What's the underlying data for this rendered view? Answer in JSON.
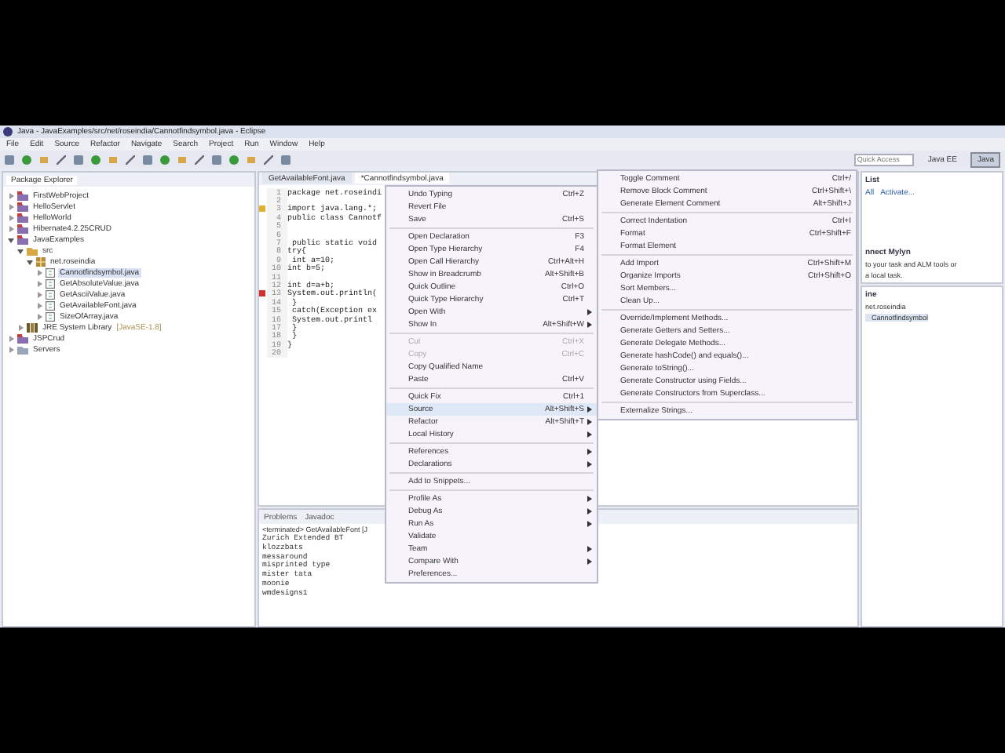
{
  "window": {
    "title": "Java - JavaExamples/src/net/roseindia/Cannotfindsymbol.java - Eclipse"
  },
  "menu_bar": [
    "File",
    "Edit",
    "Source",
    "Refactor",
    "Navigate",
    "Search",
    "Project",
    "Run",
    "Window",
    "Help"
  ],
  "toolbar": {
    "quick_access": {
      "placeholder": "Quick Access"
    },
    "perspectives": [
      {
        "label": "Java EE",
        "selected": false
      },
      {
        "label": "Java",
        "selected": true
      }
    ]
  },
  "package_explorer": {
    "title": "Package Explorer",
    "tree": [
      {
        "label": "FirstWebProject",
        "kind": "project",
        "expanded": false
      },
      {
        "label": "HelloServlet",
        "kind": "project",
        "expanded": false
      },
      {
        "label": "HelloWorld",
        "kind": "project",
        "expanded": false
      },
      {
        "label": "Hibernate4.2.25CRUD",
        "kind": "project",
        "expanded": false
      },
      {
        "label": "JavaExamples",
        "kind": "project",
        "expanded": true,
        "children": [
          {
            "label": "src",
            "kind": "folder",
            "expanded": true,
            "children": [
              {
                "label": "net.roseindia",
                "kind": "package",
                "expanded": true,
                "children": [
                  {
                    "label": "Cannotfindsymbol.java",
                    "kind": "file",
                    "expanded": false,
                    "selected": true
                  },
                  {
                    "label": "GetAbsoluteValue.java",
                    "kind": "file",
                    "expanded": false,
                    "selected": false
                  },
                  {
                    "label": "GetAsciiValue.java",
                    "kind": "file",
                    "expanded": false,
                    "selected": false
                  },
                  {
                    "label": "GetAvailableFont.java",
                    "kind": "file",
                    "expanded": false,
                    "selected": false
                  },
                  {
                    "label": "SizeOfArray.java",
                    "kind": "file",
                    "expanded": false,
                    "selected": false
                  }
                ]
              }
            ]
          },
          {
            "label": "JRE System Library",
            "note": "[JavaSE-1.8]",
            "kind": "library",
            "expanded": false
          }
        ]
      },
      {
        "label": "JSPCrud",
        "kind": "project",
        "expanded": false
      },
      {
        "label": "Servers",
        "kind": "servers",
        "expanded": false
      }
    ]
  },
  "editor": {
    "tabs": [
      {
        "label": "GetAvailableFont.java",
        "selected": false
      },
      {
        "label": "*Cannotfindsymbol.java",
        "selected": true
      }
    ],
    "lines": [
      {
        "number": "1",
        "text": "package net.roseindi"
      },
      {
        "number": "2"
      },
      {
        "number": "3",
        "text": "import java.lang.*;",
        "warning": true
      },
      {
        "number": "4",
        "text": "public class Cannotf"
      },
      {
        "number": "5"
      },
      {
        "number": "6"
      },
      {
        "number": "7",
        "text": " public static void"
      },
      {
        "number": "8",
        "text": "try{"
      },
      {
        "number": "9",
        "text": " int a=10;"
      },
      {
        "number": "10",
        "text": "int b=5;"
      },
      {
        "number": "11"
      },
      {
        "number": "12",
        "text": "int d=a+b;"
      },
      {
        "number": "13",
        "text": "System.out.println(",
        "error": true
      },
      {
        "number": "14",
        "text": " }"
      },
      {
        "number": "15",
        "text": " catch(Exception ex"
      },
      {
        "number": "16",
        "text": " System.out.printl"
      },
      {
        "number": "17",
        "text": " }"
      },
      {
        "number": "18",
        "text": " }"
      },
      {
        "number": "19",
        "text": "}"
      },
      {
        "number": "20"
      }
    ]
  },
  "console": {
    "tabs": [
      {
        "label": "Problems",
        "selected": false
      },
      {
        "label": "Javadoc",
        "selected": false
      }
    ],
    "header": "<terminated> GetAvailableFont [J",
    "lines": [
      "Zurich Extended BT",
      "klozzbats",
      "messaround",
      "misprinted type",
      "mister tata",
      "moonie",
      "wmdesigns1"
    ]
  },
  "context_menu": [
    {
      "kind": "item",
      "label": "Undo Typing",
      "shortcut": "Ctrl+Z",
      "submenu": false,
      "disabled": false,
      "selected": false
    },
    {
      "kind": "item",
      "label": "Revert File",
      "submenu": false,
      "disabled": false,
      "selected": false
    },
    {
      "kind": "item",
      "label": "Save",
      "shortcut": "Ctrl+S",
      "submenu": false,
      "disabled": false,
      "selected": false
    },
    {
      "kind": "separator"
    },
    {
      "kind": "item",
      "label": "Open Declaration",
      "shortcut": "F3",
      "submenu": false,
      "disabled": false,
      "selected": false
    },
    {
      "kind": "item",
      "label": "Open Type Hierarchy",
      "shortcut": "F4",
      "submenu": false,
      "disabled": false,
      "selected": false
    },
    {
      "kind": "item",
      "label": "Open Call Hierarchy",
      "shortcut": "Ctrl+Alt+H",
      "submenu": false,
      "disabled": false,
      "selected": false
    },
    {
      "kind": "item",
      "label": "Show in Breadcrumb",
      "shortcut": "Alt+Shift+B",
      "submenu": false,
      "disabled": false,
      "selected": false
    },
    {
      "kind": "item",
      "label": "Quick Outline",
      "shortcut": "Ctrl+O",
      "submenu": false,
      "disabled": false,
      "selected": false
    },
    {
      "kind": "item",
      "label": "Quick Type Hierarchy",
      "shortcut": "Ctrl+T",
      "submenu": false,
      "disabled": false,
      "selected": false
    },
    {
      "kind": "item",
      "label": "Open With",
      "submenu": true,
      "disabled": false,
      "selected": false
    },
    {
      "kind": "item",
      "label": "Show In",
      "shortcut": "Alt+Shift+W",
      "submenu": true,
      "disabled": false,
      "selected": false
    },
    {
      "kind": "separator"
    },
    {
      "kind": "item",
      "label": "Cut",
      "shortcut": "Ctrl+X",
      "submenu": false,
      "disabled": true,
      "selected": false
    },
    {
      "kind": "item",
      "label": "Copy",
      "shortcut": "Ctrl+C",
      "submenu": false,
      "disabled": true,
      "selected": false
    },
    {
      "kind": "item",
      "label": "Copy Qualified Name",
      "submenu": false,
      "disabled": false,
      "selected": false
    },
    {
      "kind": "item",
      "label": "Paste",
      "shortcut": "Ctrl+V",
      "submenu": false,
      "disabled": false,
      "selected": false
    },
    {
      "kind": "separator"
    },
    {
      "kind": "item",
      "label": "Quick Fix",
      "shortcut": "Ctrl+1",
      "submenu": false,
      "disabled": false,
      "selected": false
    },
    {
      "kind": "item",
      "label": "Source",
      "shortcut": "Alt+Shift+S",
      "submenu": true,
      "disabled": false,
      "selected": true
    },
    {
      "kind": "item",
      "label": "Refactor",
      "shortcut": "Alt+Shift+T",
      "submenu": true,
      "disabled": false,
      "selected": false
    },
    {
      "kind": "item",
      "label": "Local History",
      "submenu": true,
      "disabled": false,
      "selected": false
    },
    {
      "kind": "separator"
    },
    {
      "kind": "item",
      "label": "References",
      "submenu": true,
      "disabled": false,
      "selected": false
    },
    {
      "kind": "item",
      "label": "Declarations",
      "submenu": true,
      "disabled": false,
      "selected": false
    },
    {
      "kind": "separator"
    },
    {
      "kind": "item",
      "label": "Add to Snippets...",
      "submenu": false,
      "disabled": false,
      "selected": false
    },
    {
      "kind": "separator"
    },
    {
      "kind": "item",
      "label": "Profile As",
      "submenu": true,
      "disabled": false,
      "selected": false
    },
    {
      "kind": "item",
      "label": "Debug As",
      "submenu": true,
      "disabled": false,
      "selected": false
    },
    {
      "kind": "item",
      "label": "Run As",
      "submenu": true,
      "disabled": false,
      "selected": false
    },
    {
      "kind": "item",
      "label": "Validate",
      "submenu": false,
      "disabled": false,
      "selected": false
    },
    {
      "kind": "item",
      "label": "Team",
      "submenu": true,
      "disabled": false,
      "selected": false
    },
    {
      "kind": "item",
      "label": "Compare With",
      "submenu": true,
      "disabled": false,
      "selected": false
    },
    {
      "kind": "item",
      "label": "Preferences...",
      "submenu": false,
      "disabled": false,
      "selected": false
    }
  ],
  "source_submenu": [
    {
      "kind": "item",
      "label": "Toggle Comment",
      "shortcut": "Ctrl+/"
    },
    {
      "kind": "item",
      "label": "Remove Block Comment",
      "shortcut": "Ctrl+Shift+\\"
    },
    {
      "kind": "item",
      "label": "Generate Element Comment",
      "shortcut": "Alt+Shift+J"
    },
    {
      "kind": "separator"
    },
    {
      "kind": "item",
      "label": "Correct Indentation",
      "shortcut": "Ctrl+I"
    },
    {
      "kind": "item",
      "label": "Format",
      "shortcut": "Ctrl+Shift+F"
    },
    {
      "kind": "item",
      "label": "Format Element"
    },
    {
      "kind": "separator"
    },
    {
      "kind": "item",
      "label": "Add Import",
      "shortcut": "Ctrl+Shift+M"
    },
    {
      "kind": "item",
      "label": "Organize Imports",
      "shortcut": "Ctrl+Shift+O"
    },
    {
      "kind": "item",
      "label": "Sort Members..."
    },
    {
      "kind": "item",
      "label": "Clean Up..."
    },
    {
      "kind": "separator"
    },
    {
      "kind": "item",
      "label": "Override/Implement Methods..."
    },
    {
      "kind": "item",
      "label": "Generate Getters and Setters..."
    },
    {
      "kind": "item",
      "label": "Generate Delegate Methods..."
    },
    {
      "kind": "item",
      "label": "Generate hashCode() and equals()..."
    },
    {
      "kind": "item",
      "label": "Generate toString()..."
    },
    {
      "kind": "item",
      "label": "Generate Constructor using Fields..."
    },
    {
      "kind": "item",
      "label": "Generate Constructors from Superclass..."
    },
    {
      "kind": "separator"
    },
    {
      "kind": "item",
      "label": "Externalize Strings..."
    }
  ],
  "right_panel": {
    "task_list_title": "List",
    "filter_links": [
      "All",
      "Activate..."
    ],
    "mylyn_title": "nnect Mylyn",
    "mylyn_text": [
      "to your task and ALM tools or",
      "a local task."
    ],
    "outline_title": "ine",
    "outline_items": [
      "net.roseindia",
      "Cannotfindsymbol"
    ]
  }
}
